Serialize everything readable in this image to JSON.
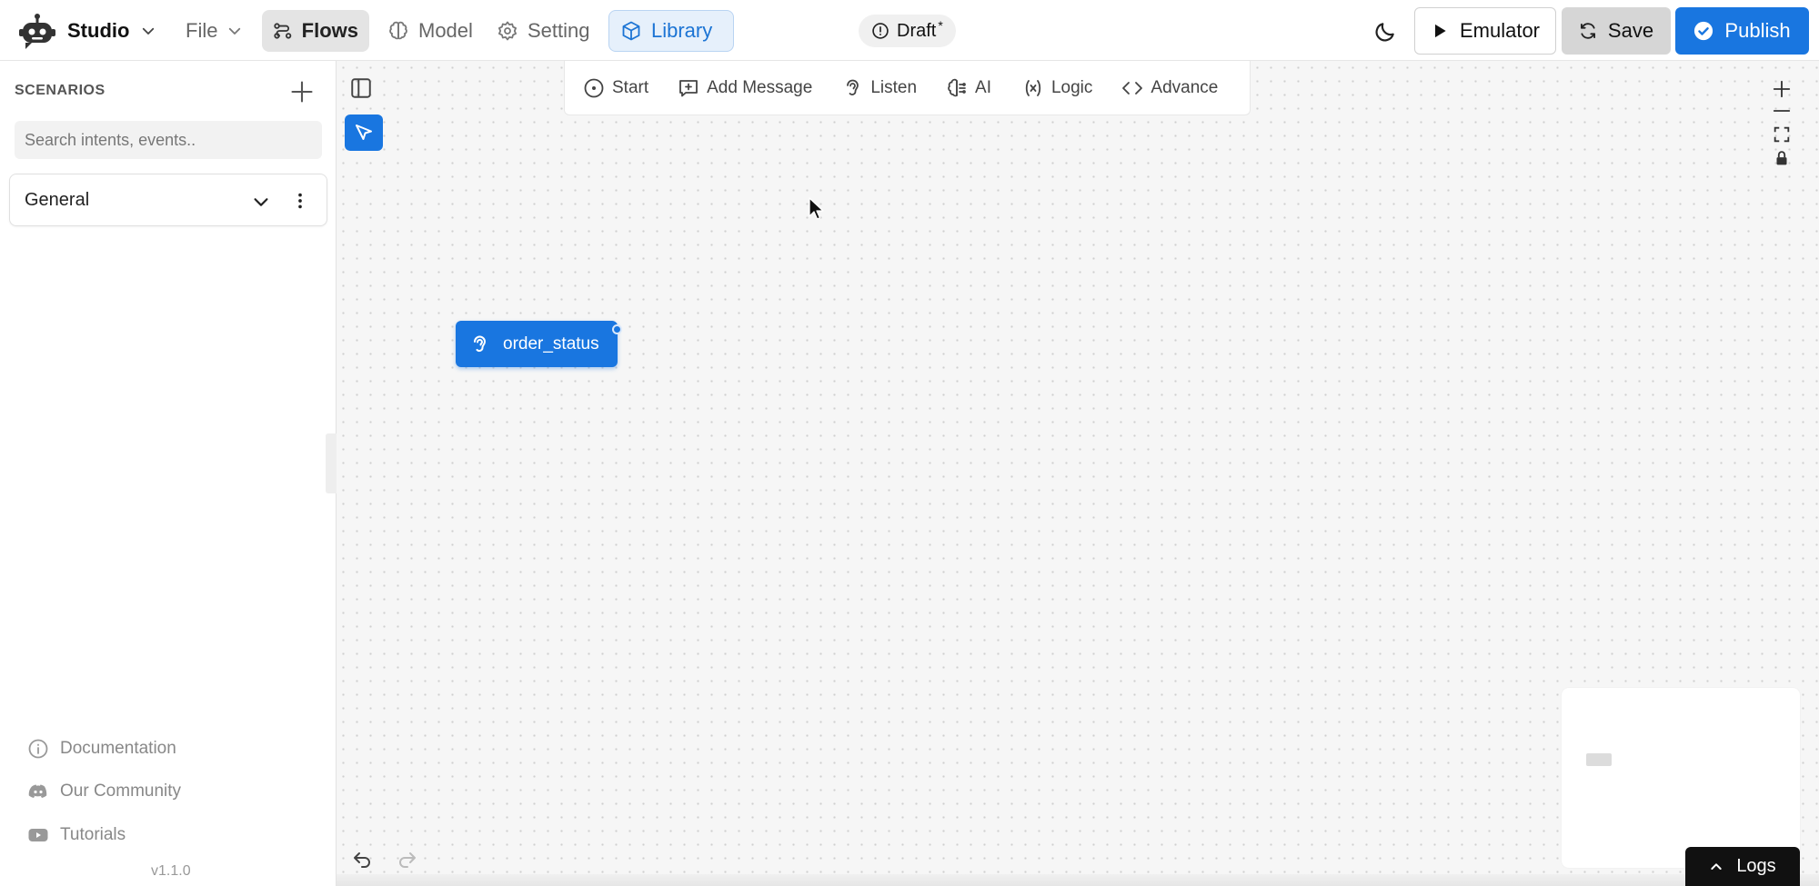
{
  "app": {
    "name": "Studio",
    "status": "Draft",
    "status_mark": "*"
  },
  "nav": {
    "file": "File",
    "flows": "Flows",
    "model": "Model",
    "setting": "Setting",
    "library": "Library"
  },
  "actions": {
    "emulator": "Emulator",
    "save": "Save",
    "publish": "Publish"
  },
  "sidebar": {
    "title": "SCENARIOS",
    "search_placeholder": "Search intents, events..",
    "groups": [
      {
        "label": "General"
      }
    ],
    "links": {
      "documentation": "Documentation",
      "community": "Our Community",
      "tutorials": "Tutorials"
    },
    "version": "v1.1.0"
  },
  "toolbar": {
    "start": "Start",
    "add_message": "Add Message",
    "listen": "Listen",
    "ai": "AI",
    "logic": "Logic",
    "advance": "Advance"
  },
  "canvas": {
    "nodes": [
      {
        "label": "order_status",
        "icon": "ear-icon"
      }
    ]
  },
  "logs": {
    "label": "Logs"
  },
  "colors": {
    "primary": "#1976e0",
    "library_bg": "#e6f0fb",
    "canvas_bg": "#f6f6f6",
    "logs_bg": "#111111"
  }
}
